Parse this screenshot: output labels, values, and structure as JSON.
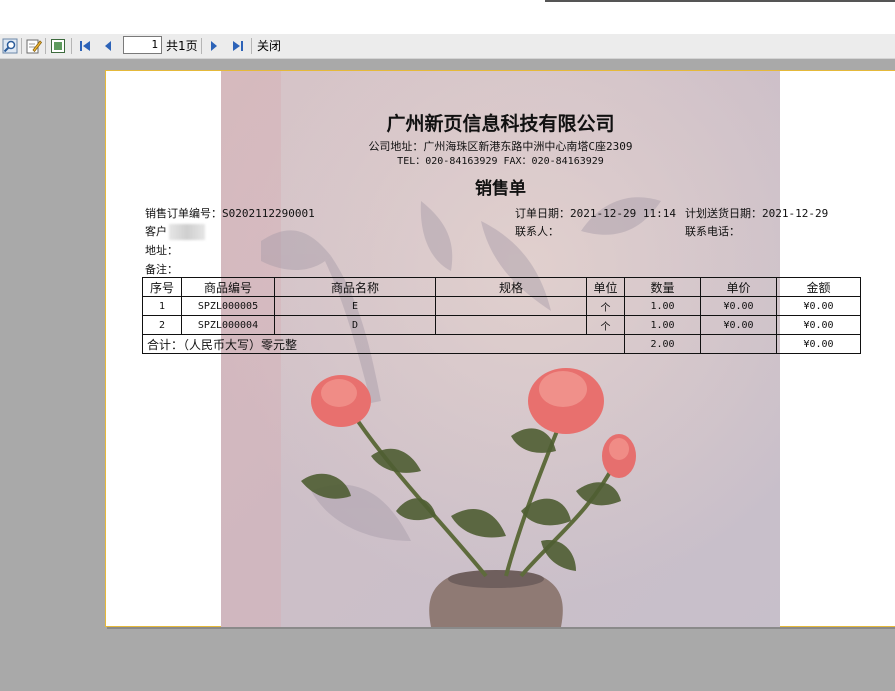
{
  "toolbar": {
    "page_value": "1",
    "page_total": "共1页",
    "close_label": "关闭"
  },
  "document": {
    "company_name": "广州新页信息科技有限公司",
    "company_address": "公司地址：广州海珠区新港东路中洲中心南塔C座2309",
    "company_contact": "TEL：020-84163929  FAX：020-84163929",
    "title": "销售单",
    "order_no_label": "销售订单编号：",
    "order_no": "S0202112290001",
    "order_date_label": "订单日期：",
    "order_date": "2021-12-29 11:14",
    "delivery_date_label": "计划送货日期：",
    "delivery_date": "2021-12-29",
    "customer_label": "客户",
    "contact_label": "联系人：",
    "phone_label": "联系电话：",
    "address_label": "地址：",
    "remark_label": "备注："
  },
  "table": {
    "headers": [
      "序号",
      "商品编号",
      "商品名称",
      "规格",
      "单位",
      "数量",
      "单价",
      "金额"
    ],
    "rows": [
      [
        "1",
        "SPZL000005",
        "E",
        "",
        "个",
        "1.00",
        "¥0.00",
        "¥0.00"
      ],
      [
        "2",
        "SPZL000004",
        "D",
        "",
        "个",
        "1.00",
        "¥0.00",
        "¥0.00"
      ]
    ],
    "total_label": "合计：（人民币大写）零元整",
    "total_qty": "2.00",
    "total_price": "",
    "total_amount": "¥0.00"
  }
}
